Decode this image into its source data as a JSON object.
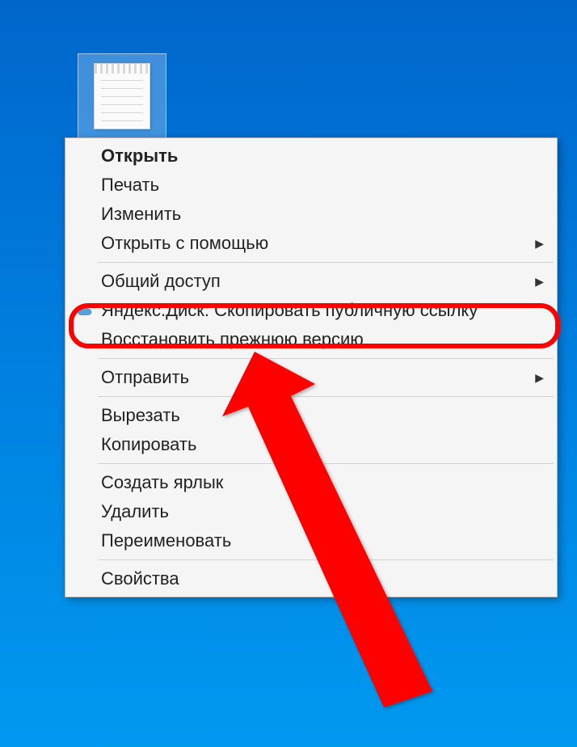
{
  "colors": {
    "highlight": "#ff0000",
    "desktop_bg": "#0080e0"
  },
  "context_menu": {
    "items": [
      {
        "label": "Открыть",
        "bold": true
      },
      {
        "label": "Печать"
      },
      {
        "label": "Изменить"
      },
      {
        "label": "Открыть с помощью",
        "submenu": true
      },
      {
        "separator": true
      },
      {
        "label": "Общий доступ",
        "submenu": true
      },
      {
        "label": "Яндекс.Диск: Скопировать публичную ссылку",
        "icon": "cloud"
      },
      {
        "label": "Восстановить прежнюю версию"
      },
      {
        "separator": true
      },
      {
        "label": "Отправить",
        "submenu": true
      },
      {
        "separator": true
      },
      {
        "label": "Вырезать"
      },
      {
        "label": "Копировать"
      },
      {
        "separator": true
      },
      {
        "label": "Создать ярлык"
      },
      {
        "label": "Удалить"
      },
      {
        "label": "Переименовать"
      },
      {
        "separator": true
      },
      {
        "label": "Свойства"
      }
    ]
  }
}
